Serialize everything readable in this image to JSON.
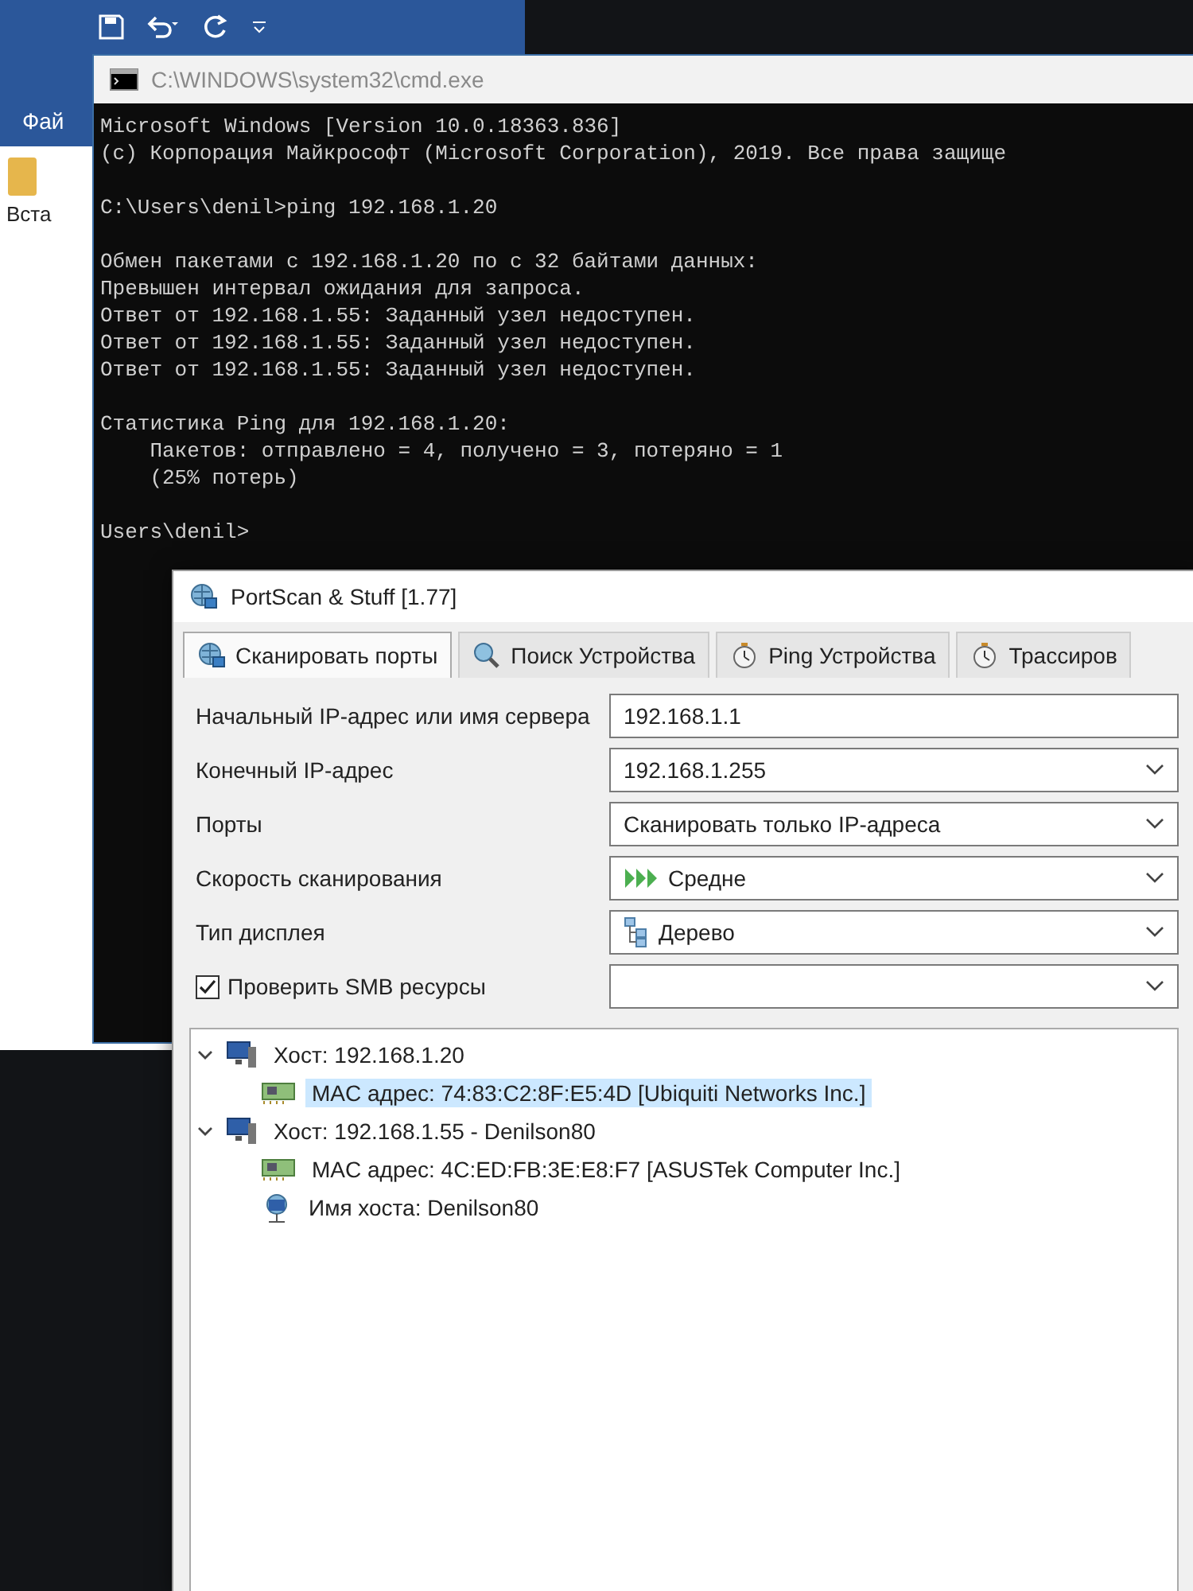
{
  "word_window": {
    "ribbon_tab": "Фай",
    "paste_label": "Вста"
  },
  "cmd_window": {
    "title": "C:\\WINDOWS\\system32\\cmd.exe",
    "blocks": [
      [
        "Microsoft Windows [Version 10.0.18363.836]",
        "(c) Корпорация Майкрософт (Microsoft Corporation), 2019. Все права защище"
      ],
      [
        "C:\\Users\\denil>ping 192.168.1.20"
      ],
      [
        "Обмен пакетами с 192.168.1.20 по с 32 байтами данных:",
        "Превышен интервал ожидания для запроса.",
        "Ответ от 192.168.1.55: Заданный узел недоступен.",
        "Ответ от 192.168.1.55: Заданный узел недоступен.",
        "Ответ от 192.168.1.55: Заданный узел недоступен."
      ],
      [
        "Статистика Ping для 192.168.1.20:",
        "    Пакетов: отправлено = 4, получено = 3, потеряно = 1",
        "    (25% потерь)"
      ],
      [
        "Users\\denil>"
      ]
    ]
  },
  "portscan_window": {
    "title": "PortScan & Stuff [1.77]",
    "tabs": [
      {
        "label": "Сканировать порты",
        "selected": true
      },
      {
        "label": "Поиск Устройства",
        "selected": false
      },
      {
        "label": "Ping Устройства",
        "selected": false
      },
      {
        "label": "Трассиров",
        "selected": false
      }
    ],
    "rows": [
      {
        "kind": "label",
        "label": "Начальный IP-адрес или имя сервера",
        "control": {
          "kind": "input",
          "value": "192.168.1.1"
        }
      },
      {
        "kind": "label",
        "label": "Конечный IP-адрес",
        "control": {
          "kind": "combo",
          "value": "192.168.1.255"
        }
      },
      {
        "kind": "label",
        "label": "Порты",
        "control": {
          "kind": "dropdown",
          "value": "Сканировать только IP-адреса"
        }
      },
      {
        "kind": "label",
        "label": "Скорость сканирования",
        "control": {
          "kind": "dropdown",
          "value": "Средне"
        }
      },
      {
        "kind": "label",
        "label": "Тип дисплея",
        "control": {
          "kind": "dropdown",
          "value": "Дерево"
        }
      },
      {
        "kind": "checkbox",
        "label": "Проверить SMB ресурсы",
        "checked": true,
        "control": {
          "kind": "dropdown"
        }
      }
    ],
    "tree": [
      {
        "kind": "host",
        "label": "Хост: 192.168.1.20",
        "expanded": true,
        "selected": false,
        "children": [
          {
            "kind": "mac",
            "label": "MAC адрес: 74:83:C2:8F:E5:4D [Ubiquiti Networks Inc.]",
            "selected": true
          }
        ]
      },
      {
        "kind": "host",
        "label": "Хост: 192.168.1.55 - Denilson80",
        "expanded": true,
        "selected": false,
        "children": [
          {
            "kind": "mac",
            "label": "MAC адрес: 4C:ED:FB:3E:E8:F7 [ASUSTek Computer Inc.]",
            "selected": false
          },
          {
            "kind": "hostname",
            "label": "Имя хоста: Denilson80",
            "selected": false
          }
        ]
      }
    ]
  }
}
